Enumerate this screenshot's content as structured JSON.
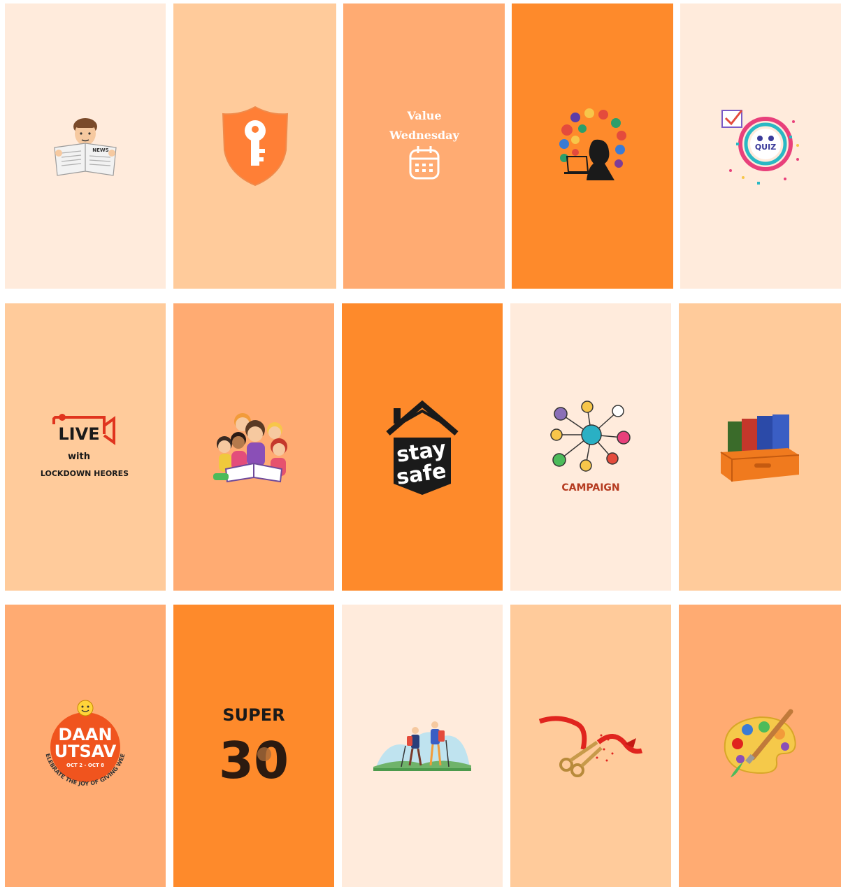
{
  "tiles": [
    {
      "name": "news-reader",
      "icon": "news-reader-icon",
      "label": "NEWS"
    },
    {
      "name": "safety-shield",
      "icon": "shield-key-icon"
    },
    {
      "name": "value-wednesday",
      "icon": "calendar-icon",
      "line1": "Value",
      "line2": "Wednesday"
    },
    {
      "name": "digital-learning",
      "icon": "student-laptop-icon"
    },
    {
      "name": "quiz",
      "icon": "quiz-icon",
      "label": "QUIZ"
    },
    {
      "name": "live-lockdown-heroes",
      "icon": "live-camera-icon",
      "live": "LIVE",
      "with": "with",
      "subtitle": "LOCKDOWN HEORES"
    },
    {
      "name": "kids-reading",
      "icon": "kids-reading-icon"
    },
    {
      "name": "stay-safe",
      "icon": "house-icon",
      "line1": "stay",
      "line2": "safe"
    },
    {
      "name": "campaign",
      "icon": "network-icon",
      "label": "CAMPAIGN"
    },
    {
      "name": "library-books",
      "icon": "books-icon"
    },
    {
      "name": "daan-utsav",
      "icon": "smiley-icon",
      "line1": "DAAN",
      "line2": "UTSAV",
      "dates": "OCT 2 - OCT 8",
      "tagline": "CELEBRATE THE JOY OF GIVING WEEK"
    },
    {
      "name": "super-30",
      "icon": "super-30-icon",
      "line1": "SUPER",
      "line2": "30"
    },
    {
      "name": "hiking",
      "icon": "hikers-icon"
    },
    {
      "name": "ribbon-cutting",
      "icon": "scissors-icon"
    },
    {
      "name": "art-palette",
      "icon": "palette-icon"
    }
  ],
  "colors": {
    "c1": "#ffebdc",
    "c2": "#ffcb9b",
    "c3": "#ffab72",
    "c4": "#fe8a2b"
  }
}
